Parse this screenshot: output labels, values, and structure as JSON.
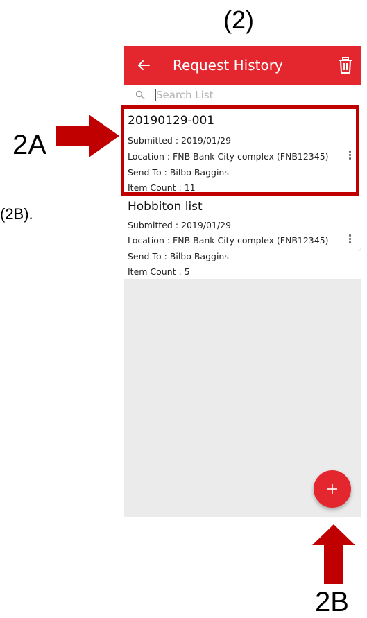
{
  "annotations": {
    "top_label": "(2)",
    "label_2a": "2A",
    "label_2b_fragment": "(2B).",
    "label_2b": "2B"
  },
  "colors": {
    "accent": "#e4262e",
    "highlight": "#c00000",
    "empty_bg": "#ebebeb"
  },
  "app_bar": {
    "back_icon": "arrow-left-icon",
    "title": "Request History",
    "trash_icon": "trash-icon"
  },
  "search": {
    "placeholder": "Search List",
    "icon": "search-icon"
  },
  "list": {
    "items": [
      {
        "title": "20190129-001",
        "submitted": "Submitted : 2019/01/29",
        "location": "Location : FNB Bank City complex (FNB12345)",
        "send_to": "Send To : Bilbo Baggins",
        "item_count": "Item Count : 11"
      },
      {
        "title": "Hobbiton list",
        "submitted": "Submitted : 2019/01/29",
        "location": "Location : FNB Bank City complex (FNB12345)",
        "send_to": "Send To : Bilbo Baggins",
        "item_count": "Item Count : 5"
      }
    ]
  },
  "fab": {
    "icon": "plus-icon"
  }
}
